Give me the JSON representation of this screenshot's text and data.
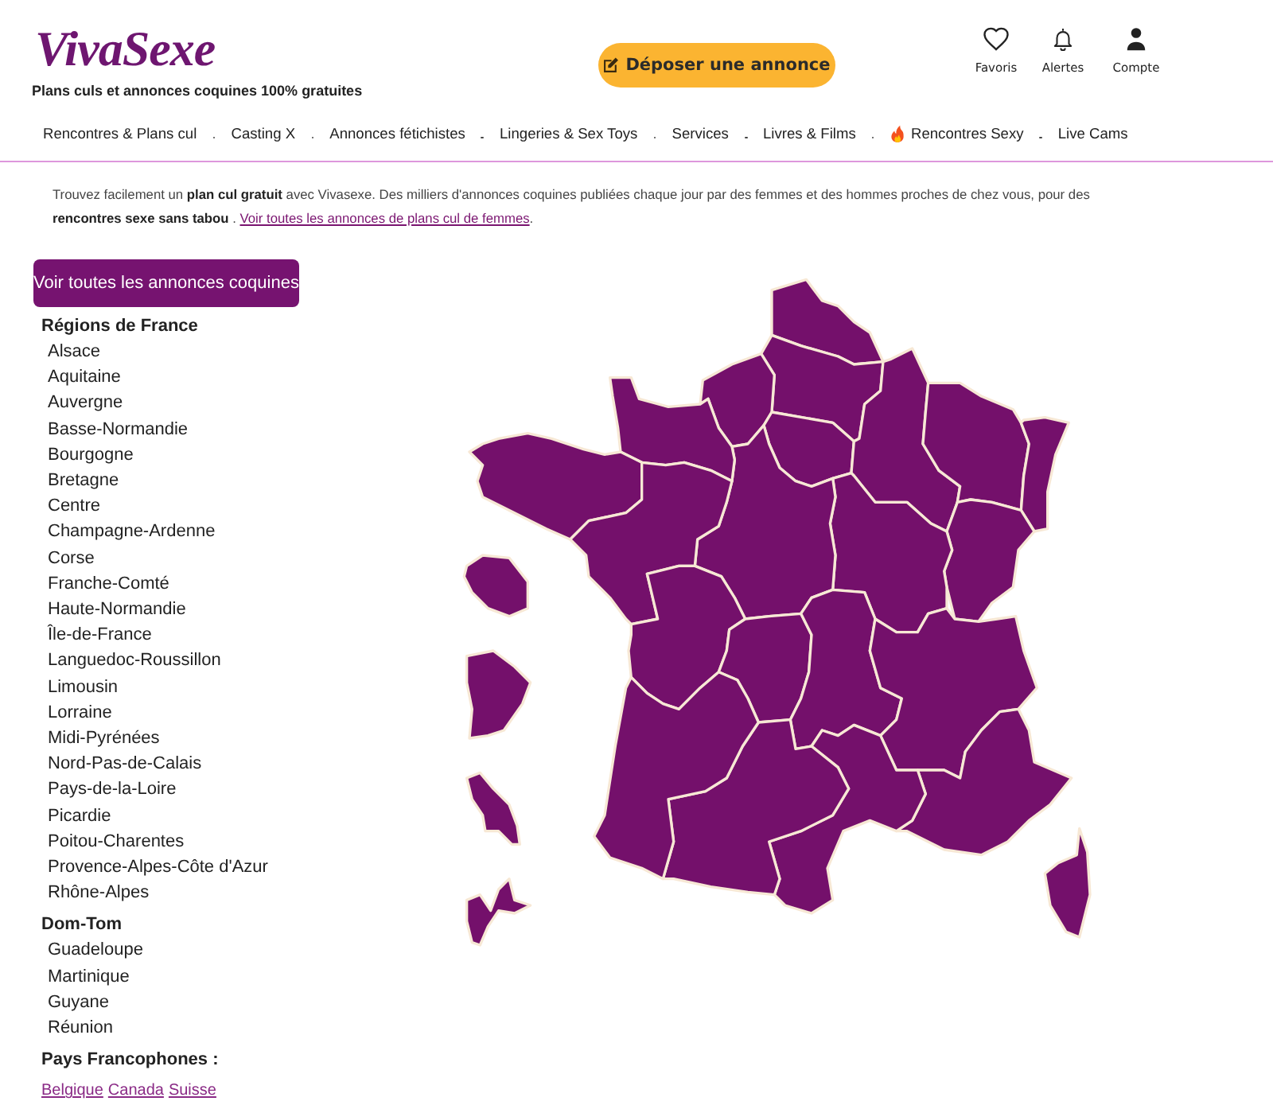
{
  "header": {
    "logo": "VivaSexe",
    "tagline": "Plans culs et annonces coquines 100% gratuites",
    "post_button": "Déposer une annonce",
    "actions": [
      {
        "label": "Favoris"
      },
      {
        "label": "Alertes"
      },
      {
        "label": "Compte"
      }
    ]
  },
  "nav": [
    {
      "label": "Rencontres & Plans cul",
      "kind": "plain"
    },
    {
      "label": "Casting X",
      "kind": "plain"
    },
    {
      "label": "Annonces fétichistes",
      "kind": "plain"
    },
    {
      "label": "Lingeries & Sex Toys",
      "kind": "plain"
    },
    {
      "label": "Services",
      "kind": "plain"
    },
    {
      "label": "Livres & Films",
      "kind": "plain"
    },
    {
      "label": "Rencontres Sexy",
      "kind": "featured"
    },
    {
      "label": "Live Cams",
      "kind": "plain"
    }
  ],
  "intro": {
    "text": "Trouvez facilement un **plan cul gratuit** avec Vivasexe. Des milliers d'annonces coquines publiées chaque jour par des femmes et des hommes proches de chez vous, pour des **rencontres sexe sans tabou** .",
    "link": "Voir toutes les annonces de plans cul de femmes",
    "end": "."
  },
  "all_ads_button": "Voir toutes les annonces coquines",
  "sidebar": [
    {
      "title": "Régions de France",
      "kind": "list",
      "items": [
        "Alsace",
        "Aquitaine",
        "Auvergne",
        "Basse-Normandie",
        "Bourgogne",
        "Bretagne",
        "Centre",
        "Champagne-Ardenne",
        "Corse",
        "Franche-Comté",
        "Haute-Normandie",
        "Île-de-France",
        "Languedoc-Roussillon",
        "Limousin",
        "Lorraine",
        "Midi-Pyrénées",
        "Nord-Pas-de-Calais",
        "Pays-de-la-Loire",
        "Picardie",
        "Poitou-Charentes",
        "Provence-Alpes-Côte d'Azur",
        "Rhône-Alpes"
      ]
    },
    {
      "title": "Dom-Tom",
      "kind": "list",
      "items": [
        "Guadeloupe",
        "Martinique",
        "Guyane",
        "Réunion"
      ]
    },
    {
      "title": "Pays Francophones :",
      "kind": "links",
      "items": [
        "Belgique",
        "Canada",
        "Suisse"
      ]
    }
  ]
}
